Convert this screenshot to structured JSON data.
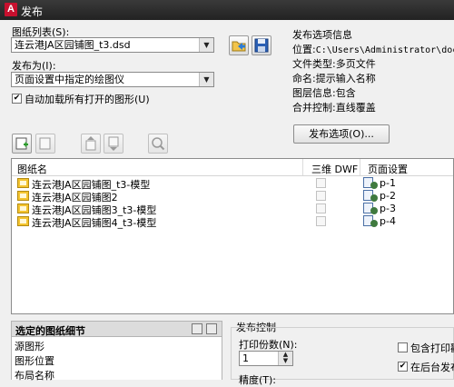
{
  "window": {
    "title": "发布",
    "logo_letter": "A"
  },
  "sheet_list": {
    "label": "图纸列表(S):",
    "value": "连云港JA区园铺图_t3.dsd"
  },
  "publish_to": {
    "label": "发布为(I):",
    "value": "页面设置中指定的绘图仪"
  },
  "auto_load": {
    "label": "自动加载所有打开的图形(U)",
    "checked": true
  },
  "options_info": {
    "title": "发布选项信息",
    "rows": [
      {
        "key": "位置:",
        "value": "C:\\Users\\Administrator\\documen"
      },
      {
        "key": "文件类型:",
        "value": "多页文件"
      },
      {
        "key": "命名:",
        "value": "提示输入名称"
      },
      {
        "key": "图层信息:",
        "value": "包含"
      },
      {
        "key": "合并控制:",
        "value": "直线覆盖"
      }
    ],
    "button_label": "发布选项(O)..."
  },
  "list": {
    "headers": {
      "name": "图纸名",
      "three_d": "三维 DWF",
      "page_setup": "页面设置"
    },
    "rows": [
      {
        "name": "连云港JA区园铺图_t3-模型",
        "page_setup": "p-1"
      },
      {
        "name": "连云港JA区园铺图2",
        "page_setup": "p-2"
      },
      {
        "name": "连云港JA区园铺图3_t3-模型",
        "page_setup": "p-3"
      },
      {
        "name": "连云港JA区园铺图4_t3-模型",
        "page_setup": "p-4"
      }
    ]
  },
  "details": {
    "title": "选定的图纸细节",
    "items": [
      "源图形",
      "图形位置",
      "布局名称"
    ]
  },
  "publish_control": {
    "title": "发布控制",
    "copies_label": "打印份数(N):",
    "copies_value": "1",
    "precision_label": "精度(T):",
    "include_stamp_label": "包含打印戳",
    "include_stamp_checked": false,
    "background_label": "在后台发布",
    "background_checked": true
  },
  "colors": {
    "titlebar": "#2b2b2b",
    "logo_red": "#c8102e",
    "sheet_icon": "#f4c430"
  }
}
